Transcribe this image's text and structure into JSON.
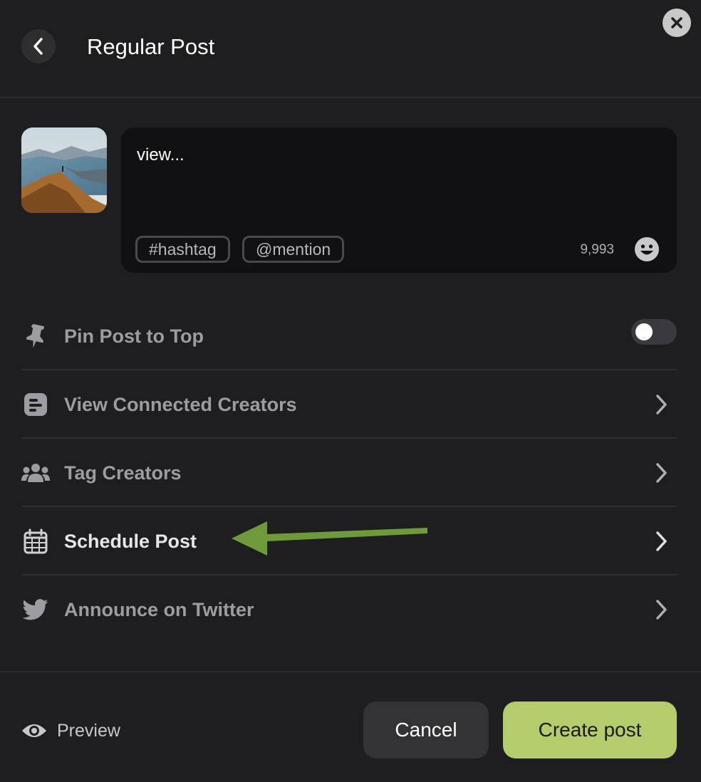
{
  "header": {
    "title": "Regular Post",
    "back_icon": "chevron-left-icon",
    "close_icon": "close-icon"
  },
  "composer": {
    "text": "view...",
    "chips": [
      "#hashtag",
      "@mention"
    ],
    "char_counter": "9,993",
    "emoji_icon": "smiley-icon"
  },
  "options": [
    {
      "label": "Pin Post to Top",
      "icon": "pin-icon",
      "control": "toggle",
      "toggle_on": false
    },
    {
      "label": "View Connected Creators",
      "icon": "document-icon",
      "control": "chevron"
    },
    {
      "label": "Tag Creators",
      "icon": "users-icon",
      "control": "chevron"
    },
    {
      "label": "Schedule Post",
      "icon": "calendar-icon",
      "control": "chevron",
      "highlighted": true
    },
    {
      "label": "Announce on Twitter",
      "icon": "twitter-icon",
      "control": "chevron"
    }
  ],
  "footer": {
    "preview_label": "Preview",
    "cancel_label": "Cancel",
    "create_label": "Create post"
  },
  "annotation": {
    "arrow_color": "#6f9a3a",
    "points_to": "Schedule Post"
  },
  "colors": {
    "background": "#1e1e20",
    "accent": "#b5cc6c",
    "composer_bg": "#111113"
  }
}
